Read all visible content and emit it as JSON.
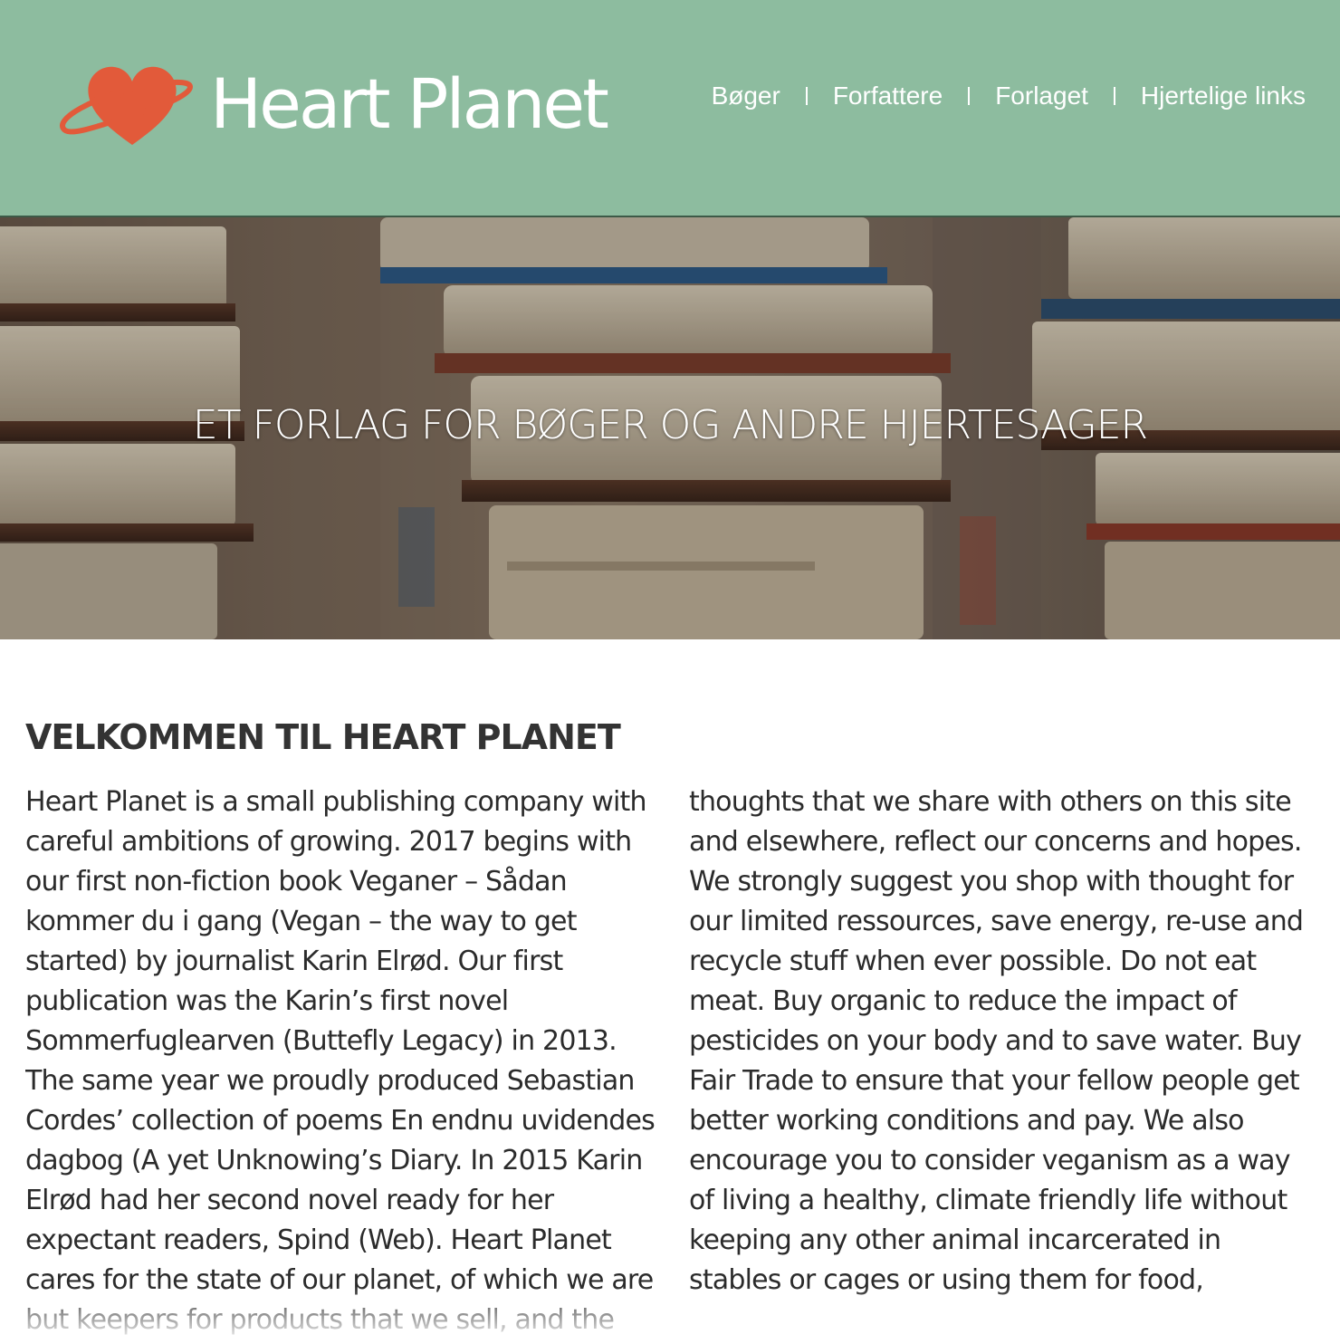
{
  "header": {
    "brand": "Heart Planet",
    "logo_icon": "heart-planet-icon",
    "background_color": "#8dbc9f",
    "logo_color": "#e25a3a",
    "nav": [
      {
        "label": "Bøger"
      },
      {
        "label": "Forfattere"
      },
      {
        "label": "Forlaget"
      },
      {
        "label": "Hjertelige links"
      }
    ],
    "separator": "I"
  },
  "hero": {
    "tagline": "ET FORLAG FOR BØGER OG ANDRE HJERTESAGER"
  },
  "content": {
    "title": "VELKOMMEN TIL HEART PLANET",
    "body": "Heart Planet is a small publishing company with careful ambitions of growing. 2017 begins with our first non-fiction book Veganer – Sådan kommer du i gang (Vegan – the way to get started) by journalist Karin Elrød. Our first publication was the Karin’s first novel Sommerfuglearven (Buttefly Legacy) in 2013. The same year we proudly produced Sebastian Cordes’ collection of poems En endnu uvidendes dagbog (A yet Unknowing’s Diary. In 2015 Karin Elrød had her second novel ready for her expectant readers, Spind (Web). Heart Planet cares for the state of our planet, of which we are but keepers for products that we sell, and the thoughts that we share with others on this site and elsewhere, reflect our concerns and hopes. We strongly suggest you shop with thought for our limited ressources, save energy, re-use and recycle stuff when ever possible. Do not eat meat. Buy organic to reduce the impact of pesticides on your body and to save water. Buy Fair Trade to ensure that your fellow people get better working conditions and pay. We also encourage you to consider veganism as a way of living a healthy, climate friendly life without keeping any other animal incarcerated in stables or cages or using them for food,"
  }
}
